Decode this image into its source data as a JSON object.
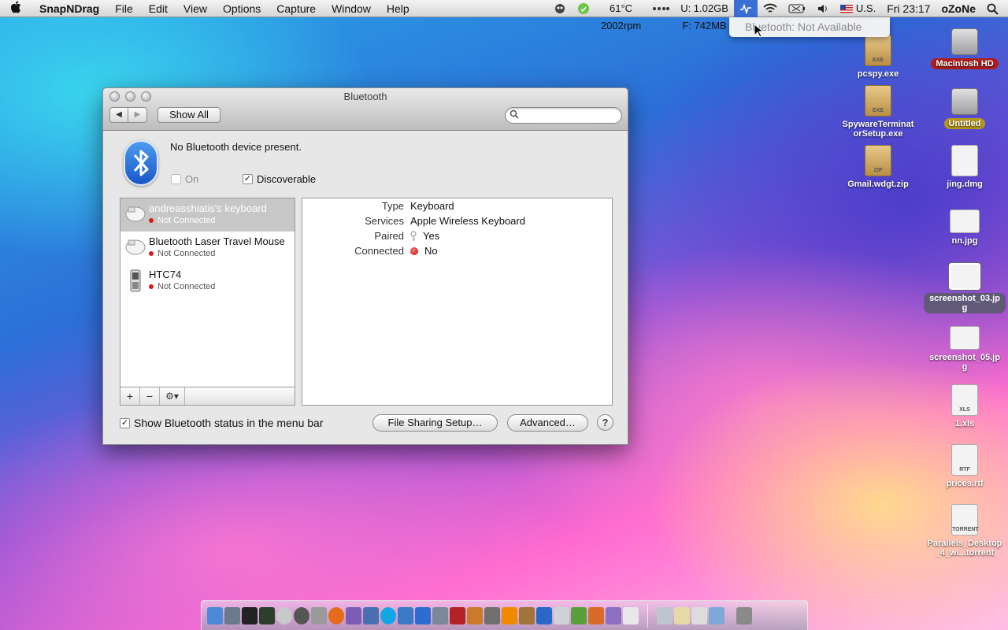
{
  "menubar": {
    "app_name": "SnapNDrag",
    "menus": [
      "File",
      "Edit",
      "View",
      "Options",
      "Capture",
      "Window",
      "Help"
    ],
    "temp": "61°C",
    "rpm": "2002rpm",
    "mem_used": "U: 1.02GB",
    "mem_free": "F: 742MB",
    "input_source": "U.S.",
    "clock": "Fri 23:17",
    "user": "oZoNe"
  },
  "bt_menu": {
    "item": "Bluetooth: Not Available"
  },
  "window": {
    "title": "Bluetooth",
    "show_all": "Show All",
    "search_placeholder": "",
    "status_text": "No Bluetooth device present.",
    "on_label": "On",
    "discoverable_label": "Discoverable",
    "show_status_label": "Show Bluetooth status in the menu bar",
    "file_sharing_label": "File Sharing Setup…",
    "advanced_label": "Advanced…",
    "help_label": "?"
  },
  "devices": [
    {
      "name": "andreasshiatis's keyboard",
      "status": "Not Connected",
      "selected": true
    },
    {
      "name": "Bluetooth Laser Travel Mouse",
      "status": "Not Connected",
      "selected": false
    },
    {
      "name": "HTC74",
      "status": "Not Connected",
      "selected": false
    }
  ],
  "details": [
    {
      "key": "Type",
      "value": "Keyboard"
    },
    {
      "key": "Services",
      "value": "Apple Wireless Keyboard"
    },
    {
      "key": "Paired",
      "value": "Yes"
    },
    {
      "key": "Connected",
      "value": "No"
    }
  ],
  "list_tools": {
    "add": "+",
    "remove": "−",
    "gear": "⚙▾"
  },
  "desktop": {
    "col1": [
      {
        "label": "pcspy.exe",
        "tag": "EXE"
      },
      {
        "label": "SpywareTerminatorSetup.exe",
        "tag": "EXE"
      },
      {
        "label": "Gmail.wdgt.zip",
        "tag": "ZIP"
      }
    ],
    "col2": [
      {
        "label": "Macintosh HD",
        "tag": ""
      },
      {
        "label": "Untitled",
        "tag": ""
      },
      {
        "label": "jing.dmg",
        "tag": ""
      },
      {
        "label": "nn.jpg",
        "tag": ""
      },
      {
        "label": "screenshot_03.jpg",
        "tag": ""
      },
      {
        "label": "screenshot_05.jpg",
        "tag": ""
      },
      {
        "label": "1.xls",
        "tag": "XLS"
      },
      {
        "label": "prices.rtf",
        "tag": "RTF"
      },
      {
        "label": "Parallels_Desktop_4_wi...torrent",
        "tag": "TORRENT"
      }
    ]
  },
  "colors": {
    "accent": "#3b6fd6",
    "status_red": "#d81a1a",
    "bluetooth_blue": "#1857c8"
  }
}
